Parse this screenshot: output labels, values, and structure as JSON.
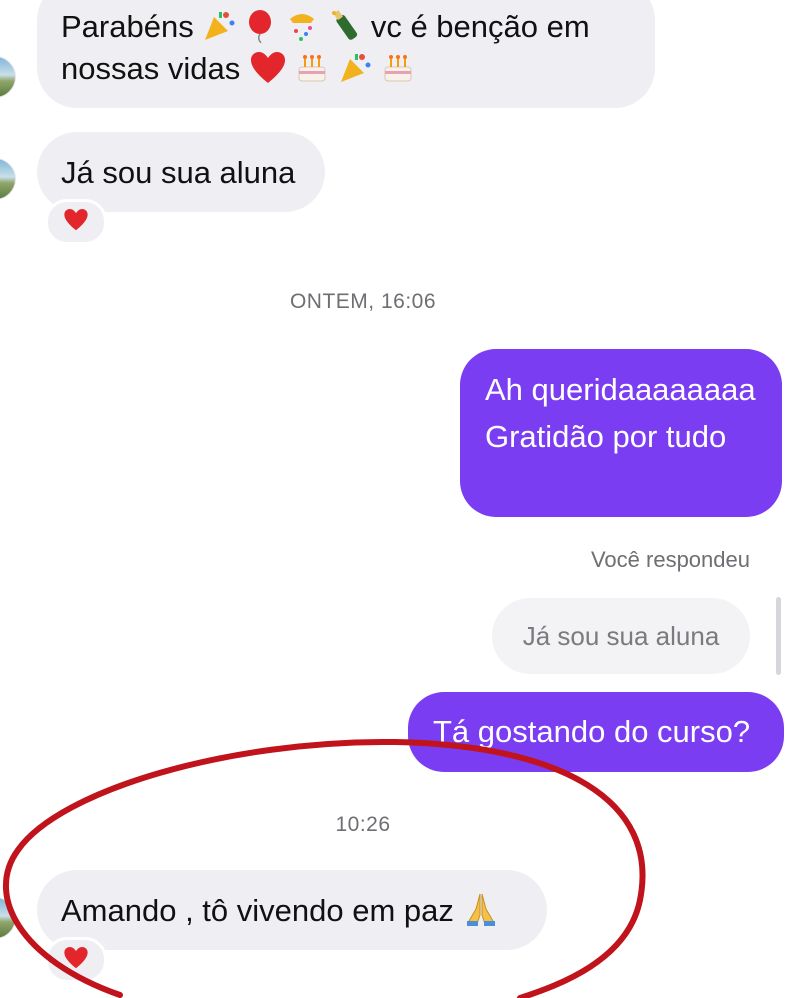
{
  "conversation": {
    "msg1": {
      "line1_text_a": "Parabéns",
      "line1_text_b": "vc é benção em",
      "line2_text": "nossas vidas"
    },
    "msg2": {
      "text": "Já sou sua aluna"
    },
    "timestamp1": "ONTEM, 16:06",
    "msg3": {
      "line1": "Ah queridaaaaaaaa",
      "line2": "Gratidão por tudo"
    },
    "reply": {
      "label": "Você respondeu",
      "quoted": "Já sou sua aluna"
    },
    "msg4": {
      "text": "Tá gostando do curso?"
    },
    "timestamp2": "10:26",
    "msg5": {
      "text": "Amando , tô vivendo em paz"
    }
  },
  "colors": {
    "outgoing_bubble": "#7b3df2",
    "incoming_bubble": "#efeff3",
    "annotation_circle": "#c0131c"
  },
  "icons": [
    "party-popper-icon",
    "balloon-icon",
    "confetti-ball-icon",
    "bottle-icon",
    "red-heart-icon",
    "birthday-cake-icon",
    "folded-hands-icon",
    "heart-reaction-icon"
  ]
}
